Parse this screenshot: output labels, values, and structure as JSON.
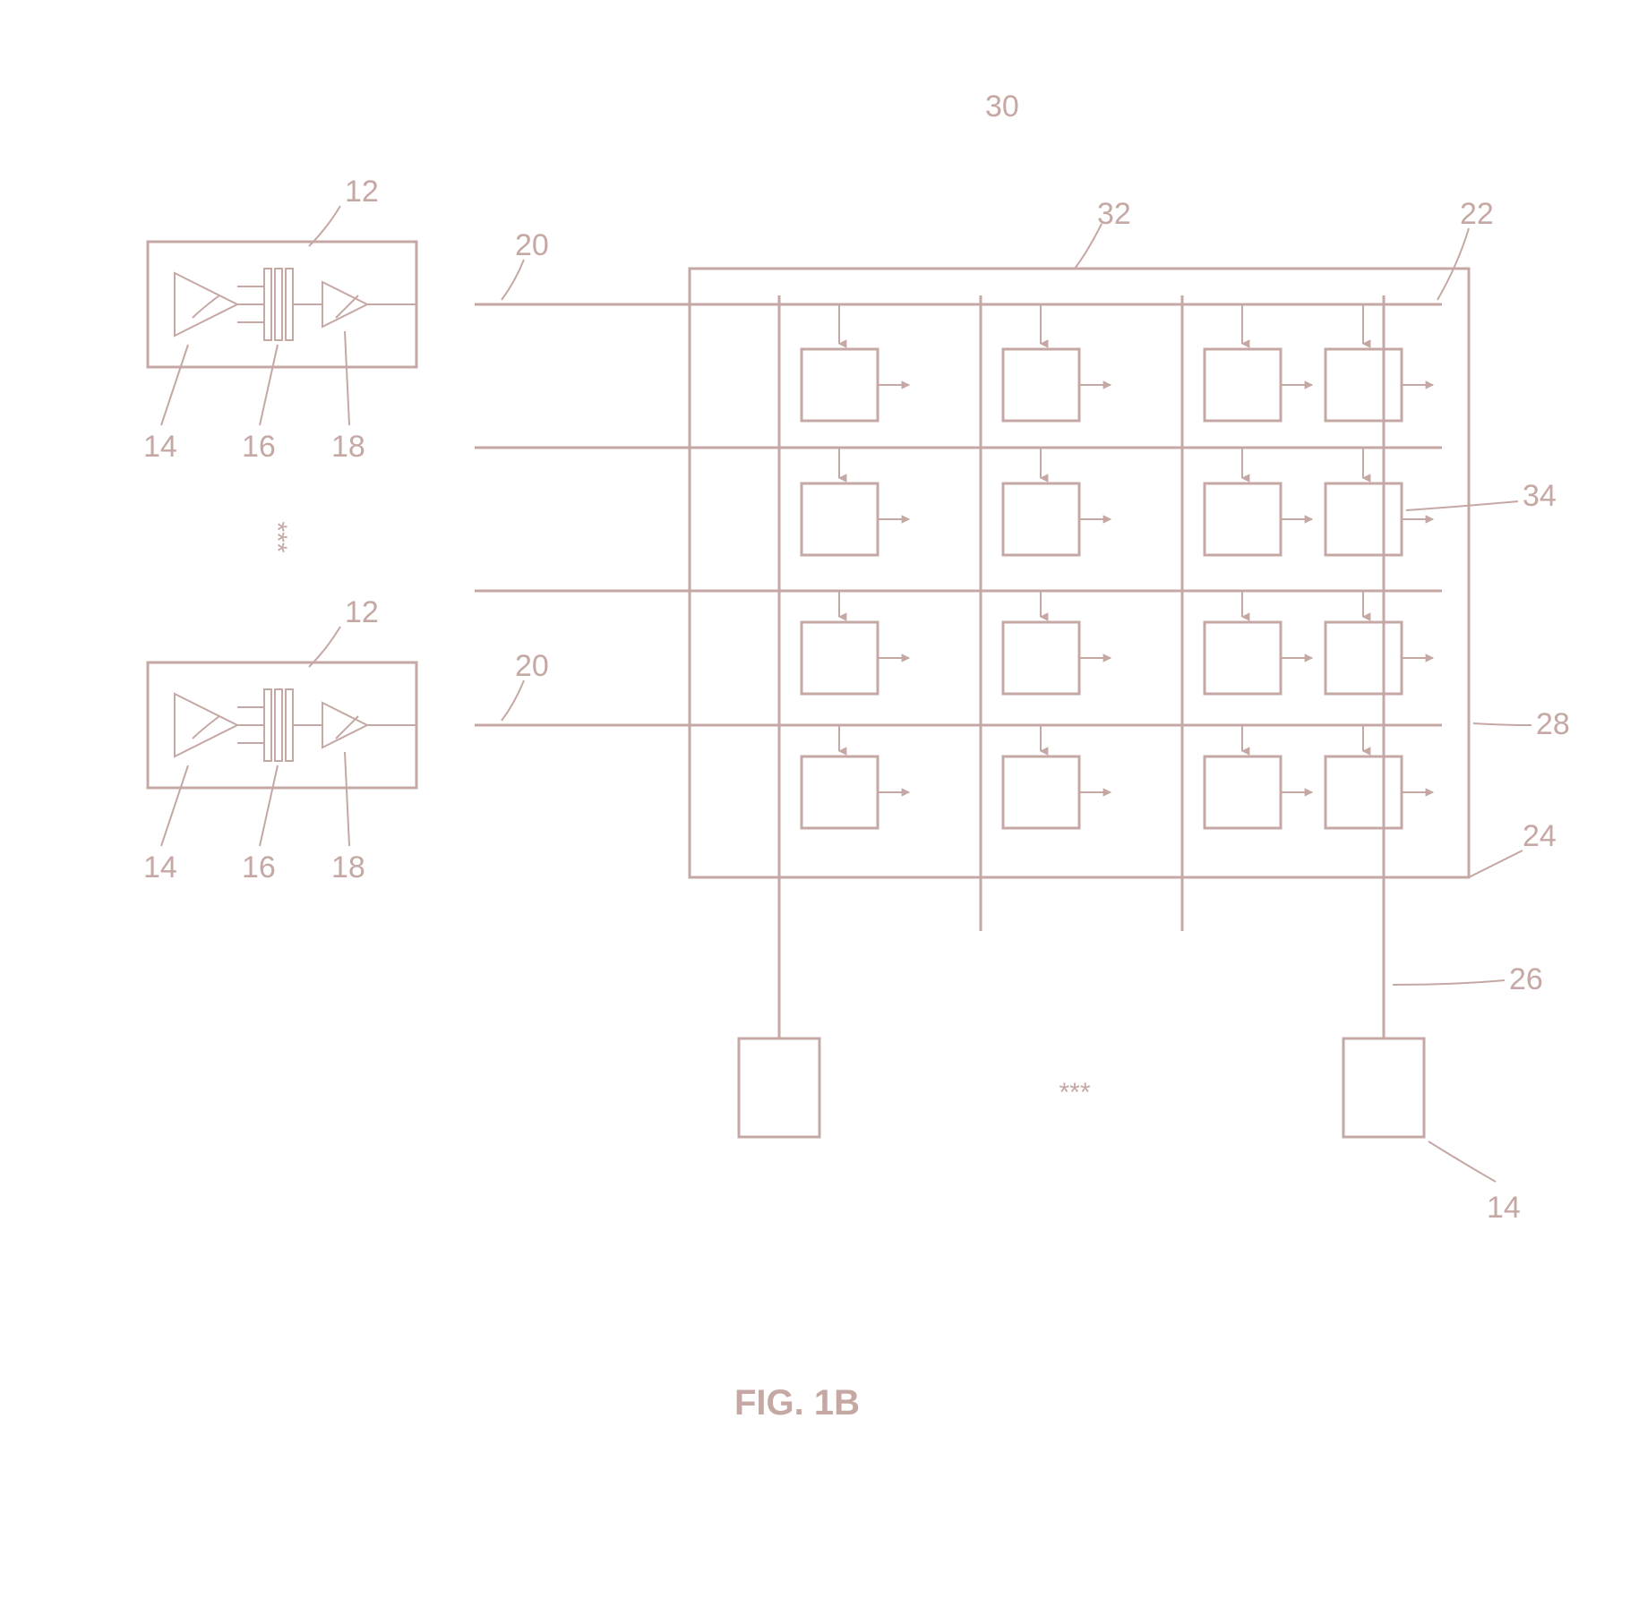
{
  "figure_caption": "FIG. 1B",
  "labels": {
    "l12a": "12",
    "l12b": "12",
    "l14a": "14",
    "l14b": "14",
    "l14c": "14",
    "l16a": "16",
    "l16b": "16",
    "l18a": "18",
    "l18b": "18",
    "l20a": "20",
    "l20b": "20",
    "l22": "22",
    "l24": "24",
    "l26": "26",
    "l28": "28",
    "l30": "30",
    "l32": "32",
    "l34": "34"
  }
}
